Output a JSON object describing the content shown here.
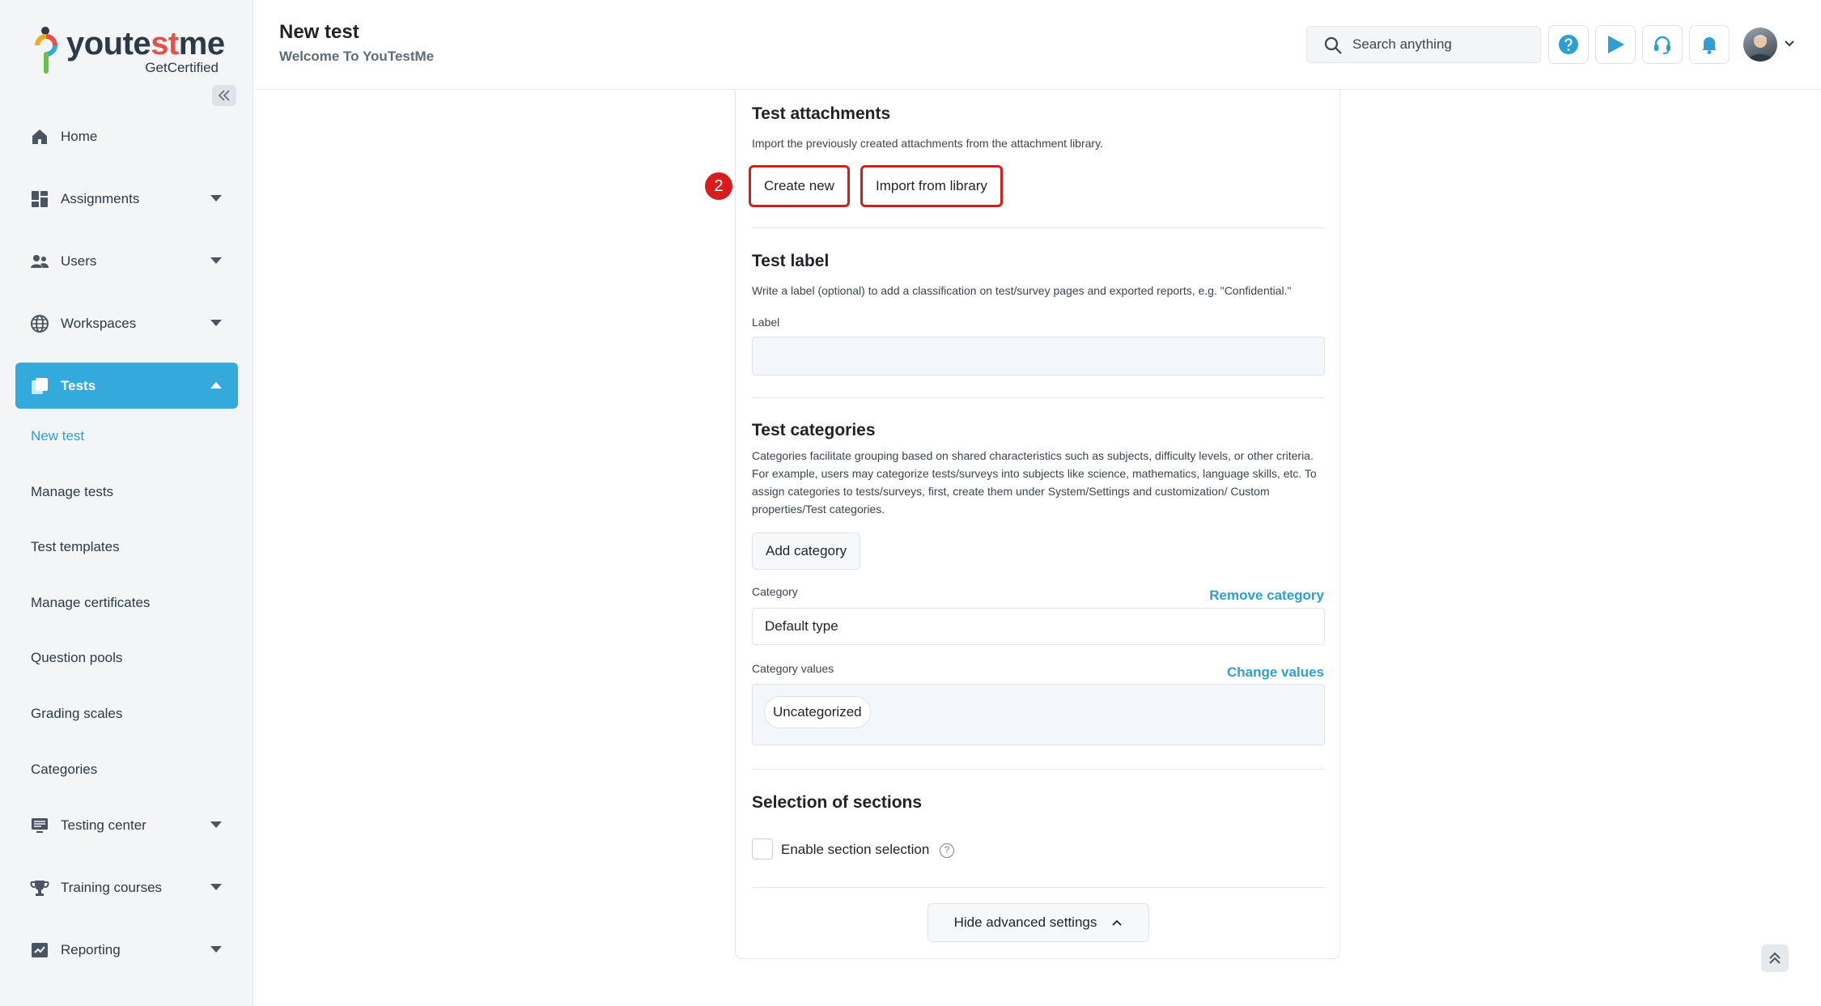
{
  "brand": {
    "logo_pre": "youte",
    "logo_accent": "st",
    "logo_post": "me",
    "tagline": "GetCertified"
  },
  "header": {
    "title": "New test",
    "subtitle": "Welcome To YouTestMe",
    "search_placeholder": "Search anything"
  },
  "sidebar": {
    "items": [
      {
        "label": "Home"
      },
      {
        "label": "Assignments"
      },
      {
        "label": "Users"
      },
      {
        "label": "Workspaces"
      },
      {
        "label": "Tests"
      }
    ],
    "tests_sub": [
      "New test",
      "Manage tests",
      "Test templates",
      "Manage certificates",
      "Question pools",
      "Grading scales",
      "Categories"
    ],
    "items_after": [
      {
        "label": "Testing center"
      },
      {
        "label": "Training courses"
      },
      {
        "label": "Reporting"
      }
    ]
  },
  "attachments": {
    "title": "Test attachments",
    "description": "Import the previously created attachments from the attachment library.",
    "step_number": "2",
    "create_label": "Create new",
    "import_label": "Import from library"
  },
  "test_label": {
    "title": "Test label",
    "description": "Write a label (optional) to add a classification on test/survey pages and exported reports, e.g. \"Confidential.\"",
    "field_label": "Label",
    "field_value": ""
  },
  "categories": {
    "title": "Test categories",
    "description": "Categories facilitate grouping based on shared characteristics such as subjects, difficulty levels, or other criteria. For example, users may categorize tests/surveys into subjects like science, mathematics, language skills, etc. To assign categories to tests/surveys, first, create them under System/Settings and customization/ Custom properties/Test categories.",
    "add_label": "Add category",
    "category_label": "Category",
    "remove_link": "Remove category",
    "category_value": "Default type",
    "values_label": "Category values",
    "change_link": "Change values",
    "chip": "Uncategorized"
  },
  "sections": {
    "title": "Selection of sections",
    "checkbox_label": "Enable section selection",
    "help_glyph": "?"
  },
  "advanced": {
    "hide_label": "Hide advanced settings"
  },
  "colors": {
    "accent": "#34a9db",
    "highlight": "#d81c1c",
    "link": "#2d9fd3"
  }
}
